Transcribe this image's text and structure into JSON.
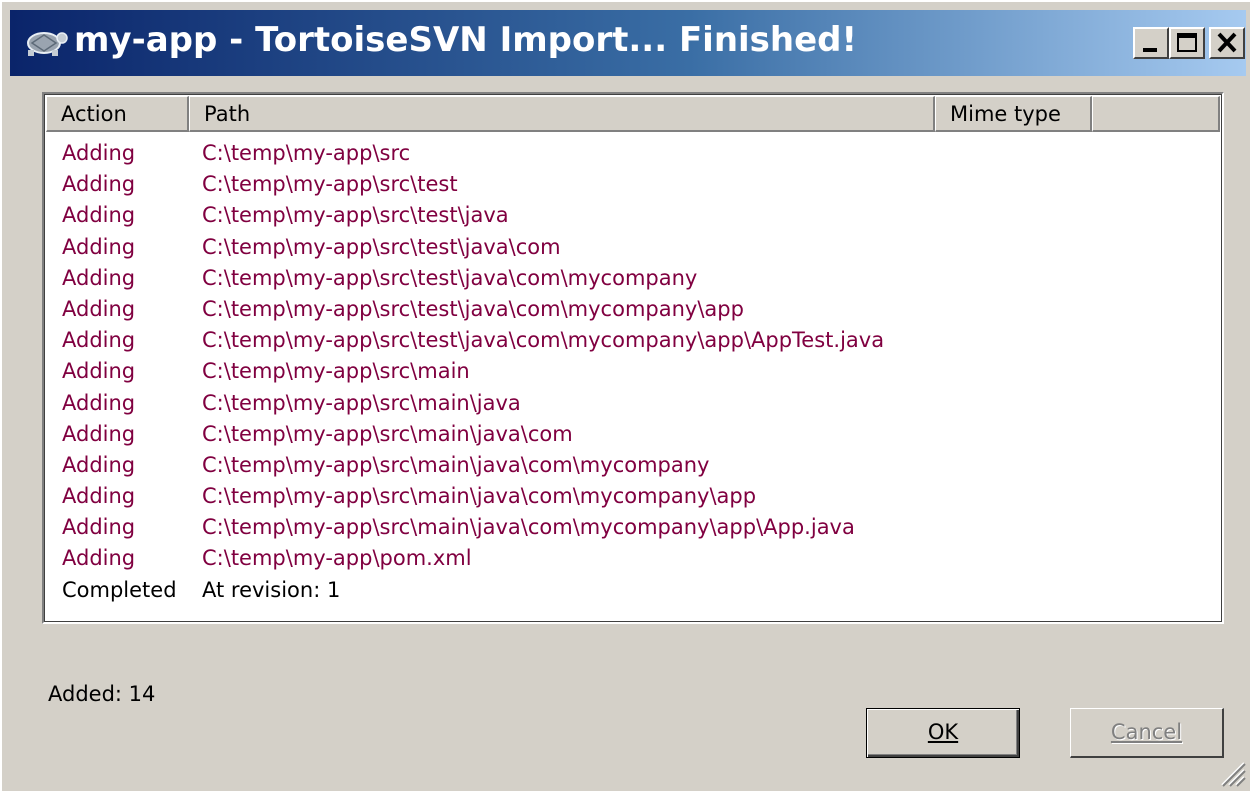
{
  "window": {
    "title": "my-app - TortoiseSVN Import... Finished!",
    "icon": "tortoise-icon",
    "controls": {
      "minimize": "minimize-icon",
      "maximize": "maximize-icon",
      "close": "close-icon"
    }
  },
  "list": {
    "columns": [
      "Action",
      "Path",
      "Mime type",
      ""
    ],
    "rows": [
      {
        "action": "Adding",
        "path": "C:\\temp\\my-app\\src"
      },
      {
        "action": "Adding",
        "path": "C:\\temp\\my-app\\src\\test"
      },
      {
        "action": "Adding",
        "path": "C:\\temp\\my-app\\src\\test\\java"
      },
      {
        "action": "Adding",
        "path": "C:\\temp\\my-app\\src\\test\\java\\com"
      },
      {
        "action": "Adding",
        "path": "C:\\temp\\my-app\\src\\test\\java\\com\\mycompany"
      },
      {
        "action": "Adding",
        "path": "C:\\temp\\my-app\\src\\test\\java\\com\\mycompany\\app"
      },
      {
        "action": "Adding",
        "path": "C:\\temp\\my-app\\src\\test\\java\\com\\mycompany\\app\\AppTest.java"
      },
      {
        "action": "Adding",
        "path": "C:\\temp\\my-app\\src\\main"
      },
      {
        "action": "Adding",
        "path": "C:\\temp\\my-app\\src\\main\\java"
      },
      {
        "action": "Adding",
        "path": "C:\\temp\\my-app\\src\\main\\java\\com"
      },
      {
        "action": "Adding",
        "path": "C:\\temp\\my-app\\src\\main\\java\\com\\mycompany"
      },
      {
        "action": "Adding",
        "path": "C:\\temp\\my-app\\src\\main\\java\\com\\mycompany\\app"
      },
      {
        "action": "Adding",
        "path": "C:\\temp\\my-app\\src\\main\\java\\com\\mycompany\\app\\App.java"
      },
      {
        "action": "Adding",
        "path": "C:\\temp\\my-app\\pom.xml"
      },
      {
        "action": "Completed",
        "path": "At revision: 1"
      }
    ],
    "colors": {
      "adding_text": "#800040",
      "completed_text": "#000000"
    }
  },
  "summary": {
    "added_label": "Added: 14"
  },
  "buttons": {
    "ok": {
      "label": "OK",
      "enabled": true
    },
    "cancel": {
      "label": "Cancel",
      "enabled": false
    }
  },
  "colors": {
    "title_gradient_start": "#0a246a",
    "title_gradient_end": "#a6caf0",
    "face": "#d4d0c8"
  }
}
